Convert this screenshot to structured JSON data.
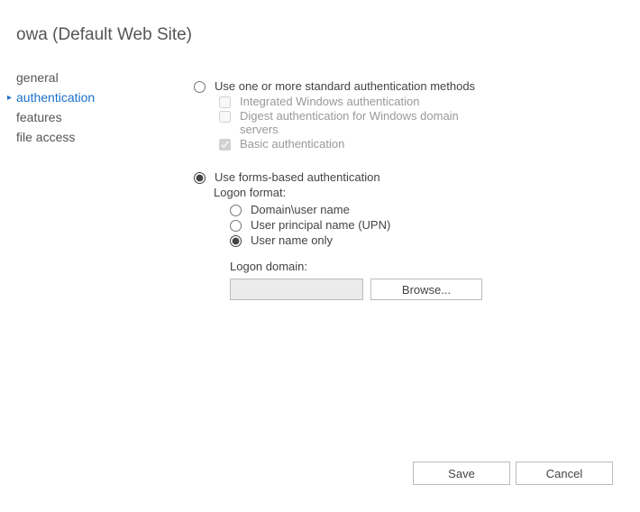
{
  "title": "owa (Default Web Site)",
  "sidebar": {
    "items": [
      {
        "label": "general"
      },
      {
        "label": "authentication"
      },
      {
        "label": "features"
      },
      {
        "label": "file access"
      }
    ],
    "active_index": 1
  },
  "auth": {
    "standard": {
      "radio_label": "Use one or more standard authentication methods",
      "selected": false,
      "iwa": {
        "label": "Integrated Windows authentication",
        "checked": false,
        "enabled": false
      },
      "digest": {
        "label": "Digest authentication for Windows domain servers",
        "checked": false,
        "enabled": false
      },
      "basic": {
        "label": "Basic authentication",
        "checked": true,
        "enabled": false
      }
    },
    "forms": {
      "radio_label": "Use forms-based authentication",
      "selected": true,
      "logon_format_label": "Logon format:",
      "options": {
        "domain_user": {
          "label": "Domain\\user name",
          "selected": false
        },
        "upn": {
          "label": "User principal name (UPN)",
          "selected": false
        },
        "user_only": {
          "label": "User name only",
          "selected": true
        }
      },
      "logon_domain_label": "Logon domain:",
      "logon_domain_value": "",
      "browse_label": "Browse..."
    }
  },
  "buttons": {
    "save": "Save",
    "cancel": "Cancel"
  }
}
